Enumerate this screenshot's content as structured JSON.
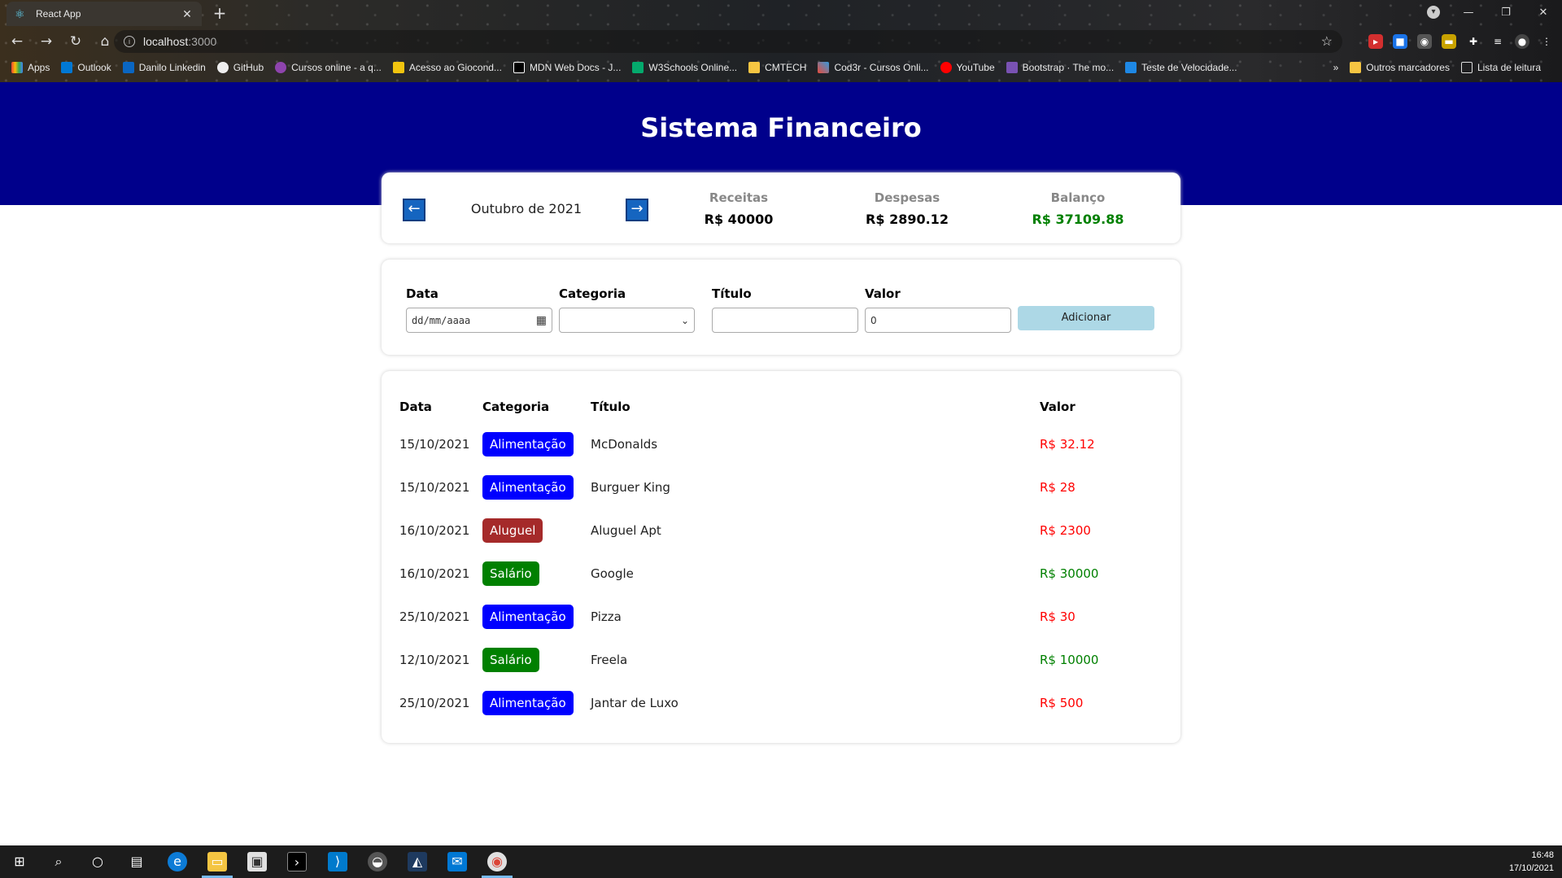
{
  "browser": {
    "tab_title": "React App",
    "url_host": "localhost",
    "url_port": ":3000",
    "bookmarks": [
      "Apps",
      "Outlook",
      "Danilo Linkedin",
      "GitHub",
      "Cursos online - a q...",
      "Acesso ao Giocond...",
      "MDN Web Docs - J...",
      "W3Schools Online...",
      "CMTECH",
      "Cod3r - Cursos Onli...",
      "YouTube",
      "Bootstrap · The mo...",
      "Teste de Velocidade..."
    ],
    "bookmarks_more": "»",
    "other_bookmarks": "Outros marcadores",
    "reading_list": "Lista de leitura"
  },
  "app": {
    "title": "Sistema Financeiro",
    "month": "Outubro de 2021",
    "prev_arrow": "←",
    "next_arrow": "→",
    "summary": {
      "income_label": "Receitas",
      "income_value": "R$ 40000",
      "expense_label": "Despesas",
      "expense_value": "R$ 2890.12",
      "balance_label": "Balanço",
      "balance_value": "R$ 37109.88",
      "balance_color": "#008000"
    },
    "form": {
      "date_label": "Data",
      "date_placeholder": "dd/mm/aaaa",
      "category_label": "Categoria",
      "category_selected": "",
      "title_label": "Título",
      "title_value": "",
      "value_label": "Valor",
      "value_value": "0",
      "add_button": "Adicionar"
    },
    "table": {
      "headers": [
        "Data",
        "Categoria",
        "Título",
        "Valor"
      ],
      "rows": [
        {
          "date": "15/10/2021",
          "category": "Alimentação",
          "category_color": "#0000ff",
          "title": "McDonalds",
          "value": "R$ 32.12",
          "value_color": "#ff0000"
        },
        {
          "date": "15/10/2021",
          "category": "Alimentação",
          "category_color": "#0000ff",
          "title": "Burguer King",
          "value": "R$ 28",
          "value_color": "#ff0000"
        },
        {
          "date": "16/10/2021",
          "category": "Aluguel",
          "category_color": "#a52a2a",
          "title": "Aluguel Apt",
          "value": "R$ 2300",
          "value_color": "#ff0000"
        },
        {
          "date": "16/10/2021",
          "category": "Salário",
          "category_color": "#008000",
          "title": "Google",
          "value": "R$ 30000",
          "value_color": "#008000"
        },
        {
          "date": "25/10/2021",
          "category": "Alimentação",
          "category_color": "#0000ff",
          "title": "Pizza",
          "value": "R$ 30",
          "value_color": "#ff0000"
        },
        {
          "date": "12/10/2021",
          "category": "Salário",
          "category_color": "#008000",
          "title": "Freela",
          "value": "R$ 10000",
          "value_color": "#008000"
        },
        {
          "date": "25/10/2021",
          "category": "Alimentação",
          "category_color": "#0000ff",
          "title": "Jantar de Luxo",
          "value": "R$ 500",
          "value_color": "#ff0000"
        }
      ]
    }
  },
  "taskbar": {
    "time": "16:48",
    "date": "17/10/2021"
  }
}
